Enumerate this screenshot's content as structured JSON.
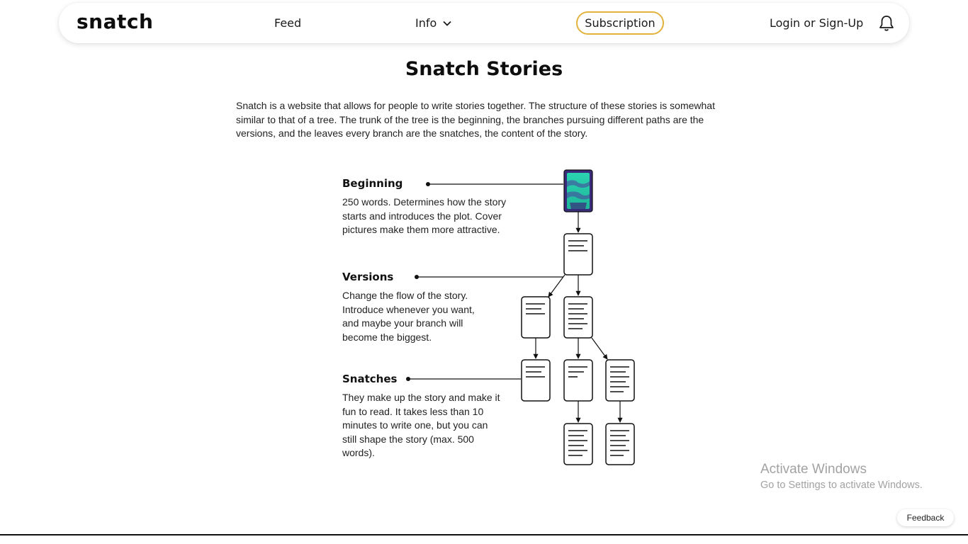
{
  "nav": {
    "brand": "snatch",
    "feed": "Feed",
    "info": "Info",
    "subscription": "Subscription",
    "login": "Login or Sign-Up",
    "icons": [
      "chevron-down-icon",
      "bell-icon"
    ],
    "accent_color": "#e3b23c"
  },
  "page": {
    "title": "Snatch Stories",
    "intro_lines": [
      "Snatch is a website that allows for people to write stories together. The structure of these stories is somewhat",
      "similar to that of a tree. The trunk of the tree is the beginning, the branches pursuing different paths are the",
      "versions, and the leaves every branch are the snatches, the content of the story."
    ]
  },
  "sections": [
    {
      "title": "Beginning",
      "desc_lines": [
        "250 words. Determines how the story",
        "starts and introduces the plot. Cover",
        "pictures make them more attractive."
      ]
    },
    {
      "title": "Versions",
      "desc_lines": [
        "Change the flow of the story.",
        "Introduce whenever you want,",
        "and maybe your branch will",
        "become the biggest."
      ]
    },
    {
      "title": "Snatches",
      "desc_lines": [
        "They make up the story and make it",
        "fun to read. It takes less than 10",
        "minutes to write one, but you can",
        "still shape the story (max. 500",
        "words)."
      ]
    }
  ],
  "watermark": {
    "title": "Activate Windows",
    "subtitle": "Go to Settings to activate Windows."
  },
  "feedback": "Feedback"
}
